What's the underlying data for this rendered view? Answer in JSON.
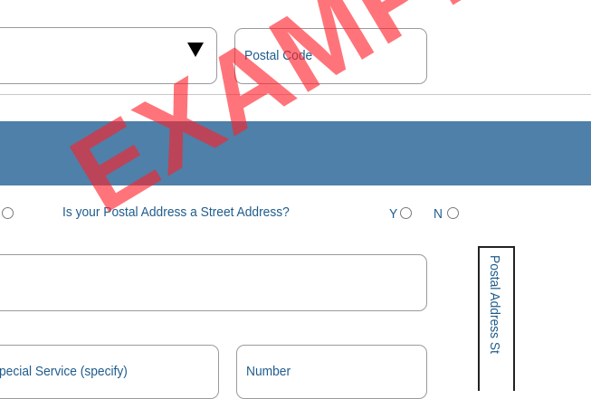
{
  "address_row": {
    "dropdown_value": "",
    "postal_code_label": "Postal Code"
  },
  "question": {
    "text": "Is your Postal Address a Street Address?",
    "yes_label": "Y",
    "no_label": "N"
  },
  "lower_fields": {
    "special_service_label": "pecial Service (specify)",
    "number_label": "Number"
  },
  "side_label": "Postal Address St",
  "watermark": "EXAMPLE",
  "colors": {
    "banner": "#4e80a9",
    "label_text": "#1f5c8c",
    "watermark": "#ff1e28"
  }
}
